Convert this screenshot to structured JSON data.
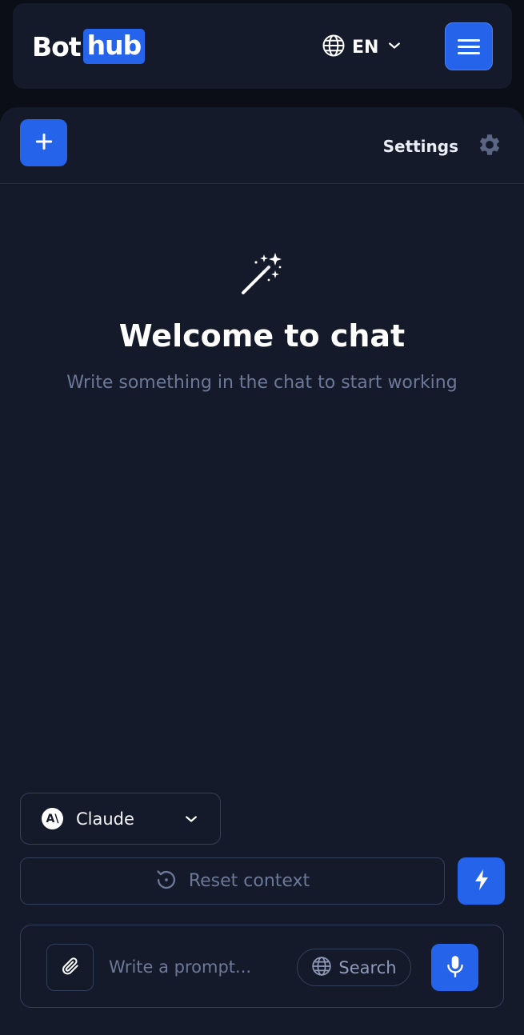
{
  "header": {
    "logo_part1": "Bot",
    "logo_part2": "hub",
    "language": "EN"
  },
  "toolbar": {
    "settings_label": "Settings"
  },
  "welcome": {
    "title": "Welcome to chat",
    "subtitle": "Write something in the chat to start working"
  },
  "model": {
    "name": "Claude",
    "logo_text": "A\\"
  },
  "reset": {
    "label": "Reset context"
  },
  "prompt": {
    "placeholder": "Write a prompt...",
    "search_label": "Search"
  },
  "colors": {
    "accent": "#2563eb",
    "panel": "#141a29",
    "muted": "#6c7898"
  }
}
